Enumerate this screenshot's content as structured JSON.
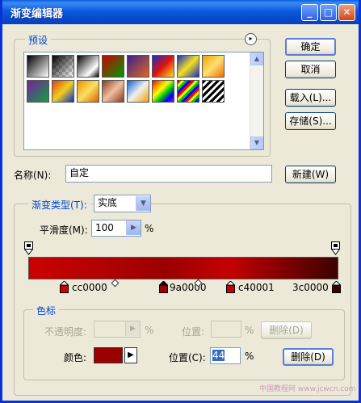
{
  "window": {
    "title": "渐变编辑器",
    "minimize": "_",
    "maximize": "□",
    "close": "✕"
  },
  "presets": {
    "legend": "预设",
    "menu_icon": "▸"
  },
  "buttons": {
    "ok": "确定",
    "cancel": "取消",
    "load": "载入(L)...",
    "save": "存储(S)...",
    "new": "新建(W)",
    "delete_opacity": "删除(D)",
    "delete_color": "删除(D)"
  },
  "name": {
    "label": "名称(N):",
    "value": "自定"
  },
  "gradient_type": {
    "label": "渐变类型(T):",
    "value": "实底"
  },
  "smoothness": {
    "label": "平滑度(M):",
    "value": "100",
    "unit": "%"
  },
  "color_stops": [
    {
      "label": "cc0000",
      "color": "#cc0000",
      "location": 0
    },
    {
      "label": "9a0000",
      "color": "#9a0000",
      "location": 44
    },
    {
      "label": "c40001",
      "color": "#c40001",
      "location": 65
    },
    {
      "label": "3c0000",
      "color": "#3c0000",
      "location": 100
    }
  ],
  "stops_section": {
    "legend": "色标",
    "opacity_label": "不透明度:",
    "opacity_unit": "%",
    "opacity_position_label": "位置:",
    "opacity_position_unit": "%",
    "color_label": "颜色:",
    "color_value": "#9a0000",
    "position_label": "位置(C):",
    "position_value": "44",
    "position_unit": "%"
  },
  "watermark": "中国教程网 www.jcwcn.com"
}
